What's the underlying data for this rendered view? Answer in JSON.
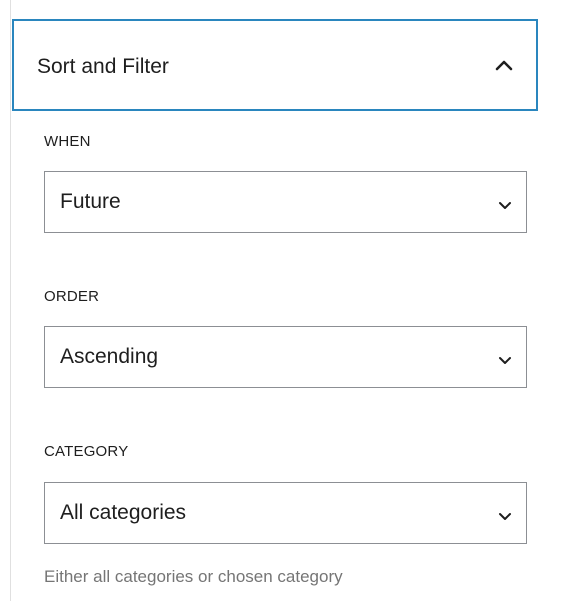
{
  "panel": {
    "title": "Sort and Filter",
    "expanded_icon": "chevron-up-icon"
  },
  "fields": {
    "when": {
      "label": "WHEN",
      "value": "Future",
      "icon": "chevron-down-icon"
    },
    "order": {
      "label": "ORDER",
      "value": "Ascending",
      "icon": "chevron-down-icon"
    },
    "category": {
      "label": "CATEGORY",
      "value": "All categories",
      "icon": "chevron-down-icon",
      "help": "Either all categories or chosen category"
    }
  },
  "colors": {
    "focus_border": "#2a86be",
    "select_border": "#8c8f94",
    "text": "#1e1e1e",
    "help_text": "#757575"
  }
}
